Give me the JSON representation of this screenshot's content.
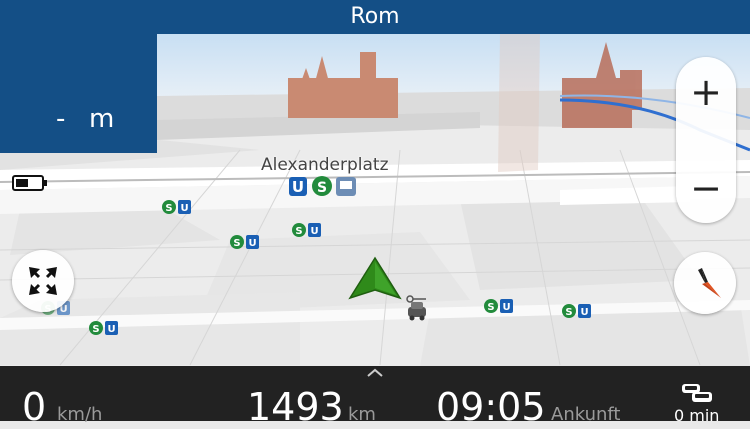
{
  "header": {
    "destination": "Rom"
  },
  "maneuver": {
    "distance_value": "-",
    "distance_unit": "m"
  },
  "map": {
    "poi_label": "Alexanderplatz"
  },
  "zoom": {
    "in_label": "+",
    "out_label": "−"
  },
  "status_bar": {
    "speed_value": "0",
    "speed_unit": "km/h",
    "distance_value": "1493",
    "distance_unit": "km",
    "arrival_time": "09:05",
    "arrival_label": "Ankunft",
    "traffic_delay": "0 min"
  },
  "transit_badges": {
    "sbahn": "S",
    "ubahn": "U"
  },
  "icons": [
    "battery-icon",
    "expand-icon",
    "compass-icon",
    "position-arrow-icon",
    "car-icon",
    "traffic-icon",
    "chevron-up-icon"
  ],
  "colors": {
    "header_blue": "#144f86",
    "sbahn_green": "#228b3c",
    "ubahn_blue": "#1a5fb4",
    "position_green": "#2f8a1a",
    "route_blue": "#2f6fd0",
    "bottom_bar": "#222222"
  }
}
